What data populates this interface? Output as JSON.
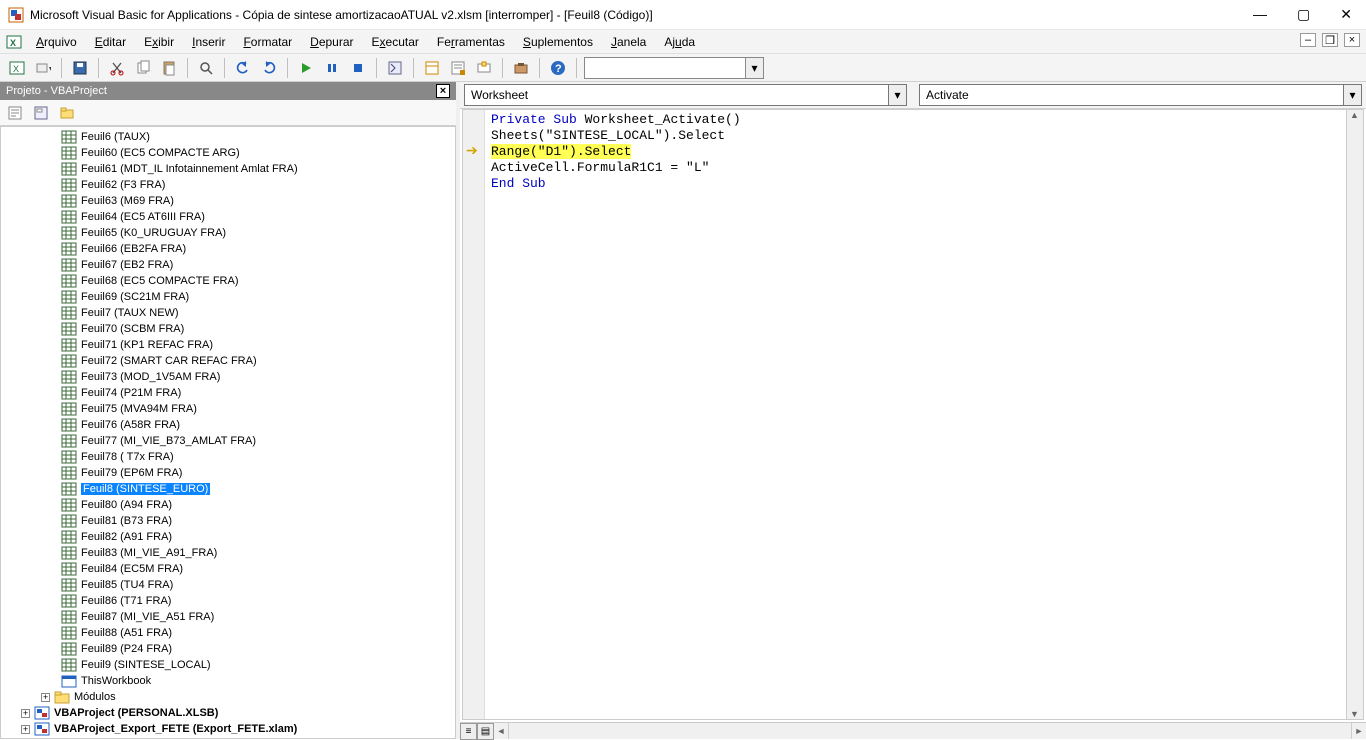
{
  "title": "Microsoft Visual Basic for Applications - Cópia de sintese amortizacaoATUAL v2.xlsm [interromper] - [Feuil8 (Código)]",
  "menu": {
    "arquivo": "Arquivo",
    "editar": "Editar",
    "exibir": "Exibir",
    "inserir": "Inserir",
    "formatar": "Formatar",
    "depurar": "Depurar",
    "executar": "Executar",
    "ferramentas": "Ferramentas",
    "suplementos": "Suplementos",
    "janela": "Janela",
    "ajuda": "Ajuda"
  },
  "panel": {
    "title": "Projeto - VBAProject"
  },
  "combos": {
    "object": "Worksheet",
    "procedure": "Activate"
  },
  "tree": [
    "Feuil6 (TAUX)",
    "Feuil60 (EC5 COMPACTE ARG)",
    "Feuil61 (MDT_IL Infotainnement Amlat FRA)",
    "Feuil62 (F3 FRA)",
    "Feuil63 (M69 FRA)",
    "Feuil64 (EC5 AT6III FRA)",
    "Feuil65 (K0_URUGUAY FRA)",
    "Feuil66 (EB2FA FRA)",
    "Feuil67 (EB2 FRA)",
    "Feuil68 (EC5 COMPACTE FRA)",
    "Feuil69 (SC21M FRA)",
    "Feuil7 (TAUX NEW)",
    "Feuil70 (SCBM FRA)",
    "Feuil71 (KP1 REFAC FRA)",
    "Feuil72 (SMART CAR REFAC FRA)",
    "Feuil73 (MOD_1V5AM FRA)",
    "Feuil74 (P21M FRA)",
    "Feuil75 (MVA94M FRA)",
    "Feuil76 (A58R FRA)",
    "Feuil77 (MI_VIE_B73_AMLAT FRA)",
    "Feuil78 ( T7x FRA)",
    "Feuil79 (EP6M FRA)",
    "Feuil8 (SINTESE_EURO)",
    "Feuil80 (A94 FRA)",
    "Feuil81 (B73 FRA)",
    "Feuil82 (A91 FRA)",
    "Feuil83 (MI_VIE_A91_FRA)",
    "Feuil84 (EC5M FRA)",
    "Feuil85 (TU4 FRA)",
    "Feuil86 (T71 FRA)",
    "Feuil87 (MI_VIE_A51 FRA)",
    "Feuil88 (A51 FRA)",
    "Feuil89 (P24 FRA)",
    "Feuil9 (SINTESE_LOCAL)",
    "ThisWorkbook"
  ],
  "tree_selected_index": 22,
  "tree_extra": {
    "modulos": "Módulos",
    "personal": "VBAProject (PERSONAL.XLSB)",
    "export": "VBAProject_Export_FETE (Export_FETE.xlam)"
  },
  "code": {
    "l1_kw1": "Private Sub",
    "l1_rest": " Worksheet_Activate()",
    "l2": "Sheets(\"SINTESE_LOCAL\").Select",
    "l3": "Range(\"D1\").Select",
    "l4": "ActiveCell.FormulaR1C1 = \"L\"",
    "l5": "End Sub"
  }
}
